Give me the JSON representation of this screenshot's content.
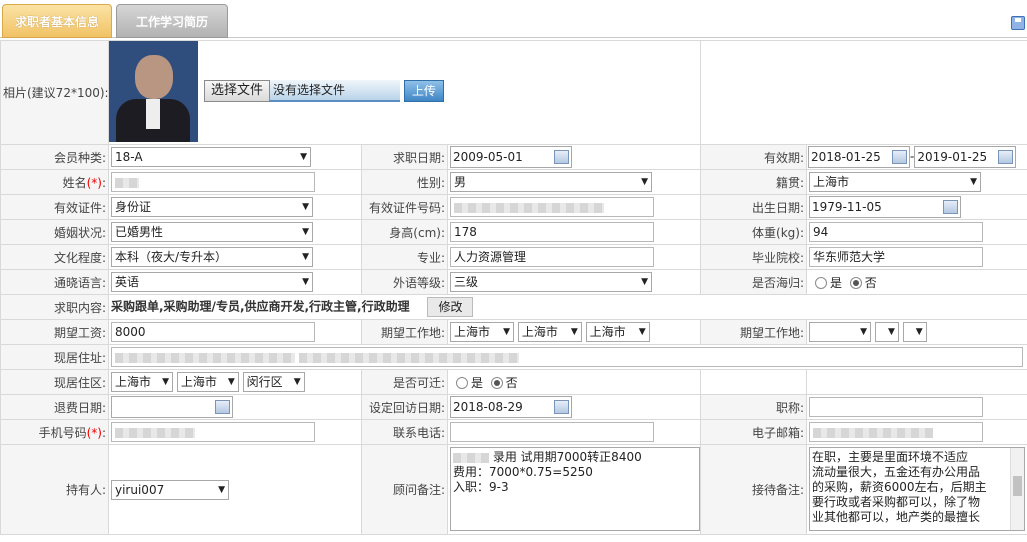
{
  "tabs": {
    "active": "求职者基本信息",
    "inactive": "工作学习简历"
  },
  "photo": {
    "label": "相片(建议72*100):",
    "choose_btn": "选择文件",
    "no_file": "没有选择文件",
    "upload_btn": "上传"
  },
  "row_member": {
    "member_label": "会员种类:",
    "member_value": "18-A",
    "apply_date_label": "求职日期:",
    "apply_date": "2009-05-01",
    "valid_label": "有效期:",
    "valid_from": "2018-01-25",
    "sep": "-",
    "valid_to": "2019-01-25"
  },
  "row_name": {
    "name_label": "姓名",
    "req": "(*)",
    "colon": ":",
    "gender_label": "性别:",
    "gender": "男",
    "native_label": "籍贯:",
    "native": "上海市"
  },
  "row_id": {
    "id_type_label": "有效证件:",
    "id_type": "身份证",
    "id_no_label": "有效证件号码:",
    "birth_label": "出生日期:",
    "birth": "1979-11-05"
  },
  "row_marital": {
    "marital_label": "婚姻状况:",
    "marital": "已婚男性",
    "height_label": "身高(cm):",
    "height": "178",
    "weight_label": "体重(kg):",
    "weight": "94"
  },
  "row_edu": {
    "edu_label": "文化程度:",
    "edu": "本科（夜大/专升本）",
    "major_label": "专业:",
    "major": "人力资源管理",
    "school_label": "毕业院校:",
    "school": "华东师范大学"
  },
  "row_lang": {
    "lang_label": "通晓语言:",
    "lang": "英语",
    "level_label": "外语等级:",
    "level": "三级",
    "overseas_label": "是否海归:",
    "yes": "是",
    "no": "否"
  },
  "row_job": {
    "job_label": "求职内容:",
    "job": "采购跟单,采购助理/专员,供应商开发,行政主管,行政助理",
    "edit_btn": "修改"
  },
  "row_salary": {
    "salary_label": "期望工资:",
    "salary": "8000",
    "loc_label": "期望工作地:",
    "loc1": "上海市",
    "loc2": "上海市",
    "loc3": "上海市",
    "loc_label2": "期望工作地:"
  },
  "row_addr": {
    "addr_label": "现居住址:"
  },
  "row_area": {
    "area_label": "现居住区:",
    "area1": "上海市",
    "area2": "上海市",
    "area3": "闵行区",
    "move_label": "是否可迁:",
    "yes": "是",
    "no": "否"
  },
  "row_refund": {
    "refund_label": "退费日期:",
    "revisit_label": "设定回访日期:",
    "revisit": "2018-08-29",
    "title_label": "职称:"
  },
  "row_phone": {
    "mobile_label": "手机号码",
    "req": "(*)",
    "colon": ":",
    "tel_label": "联系电话:",
    "email_label": "电子邮箱:"
  },
  "row_notes": {
    "holder_label": "持有人:",
    "holder": "yirui007",
    "consult_label": "顾问备注:",
    "consult_note": "录用 试用期7000转正8400\n费用：7000*0.75=5250\n入职：9-3",
    "reception_label": "接待备注:",
    "reception_note": "在职，主要是里面环境不适应\n流动量很大，五金还有办公用品\n的采购，薪资6000左右，后期主\n要行政或者采购都可以，除了物\n业其他都可以，地产类的最擅长"
  }
}
